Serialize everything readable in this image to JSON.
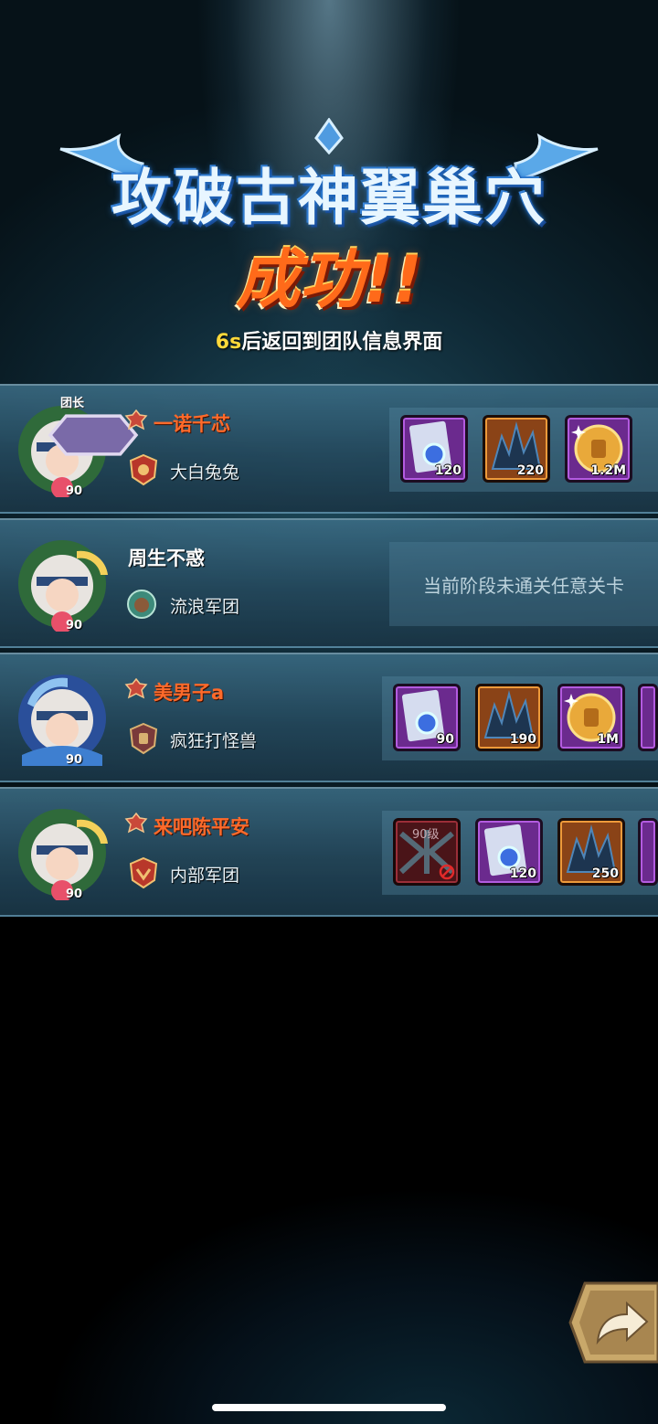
{
  "header": {
    "title": "攻破古神翼巢穴",
    "result": "成功!!",
    "countdown_number": "6s",
    "countdown_text": "后返回到团队信息界面"
  },
  "leader_badge": "团长",
  "players": [
    {
      "name": "一诺千芯",
      "guild": "大白兔兔",
      "level": "90",
      "rewards": [
        {
          "icon": "scroll-icon",
          "rarity": "purple",
          "qty": "120"
        },
        {
          "icon": "crystal-icon",
          "rarity": "orange",
          "qty": "220"
        },
        {
          "icon": "gold-coin-icon",
          "rarity": "purple",
          "qty": "1.2M"
        }
      ]
    },
    {
      "name": "周生不惑",
      "guild": "流浪军团",
      "level": "90",
      "status": "当前阶段未通关任意关卡"
    },
    {
      "name": "美男子a",
      "guild": "疯狂打怪兽",
      "level": "90",
      "rewards": [
        {
          "icon": "scroll-icon",
          "rarity": "purple",
          "qty": "90"
        },
        {
          "icon": "crystal-icon",
          "rarity": "orange",
          "qty": "190"
        },
        {
          "icon": "gold-coin-icon",
          "rarity": "purple",
          "qty": "1M"
        }
      ]
    },
    {
      "name": "来吧陈平安",
      "guild": "内部军团",
      "level": "90",
      "rewards": [
        {
          "icon": "locked-wing-icon",
          "rarity": "red",
          "qty": "",
          "level_tag": "90级"
        },
        {
          "icon": "scroll-icon",
          "rarity": "purple",
          "qty": "120"
        },
        {
          "icon": "crystal-icon",
          "rarity": "orange",
          "qty": "250"
        }
      ]
    }
  ]
}
